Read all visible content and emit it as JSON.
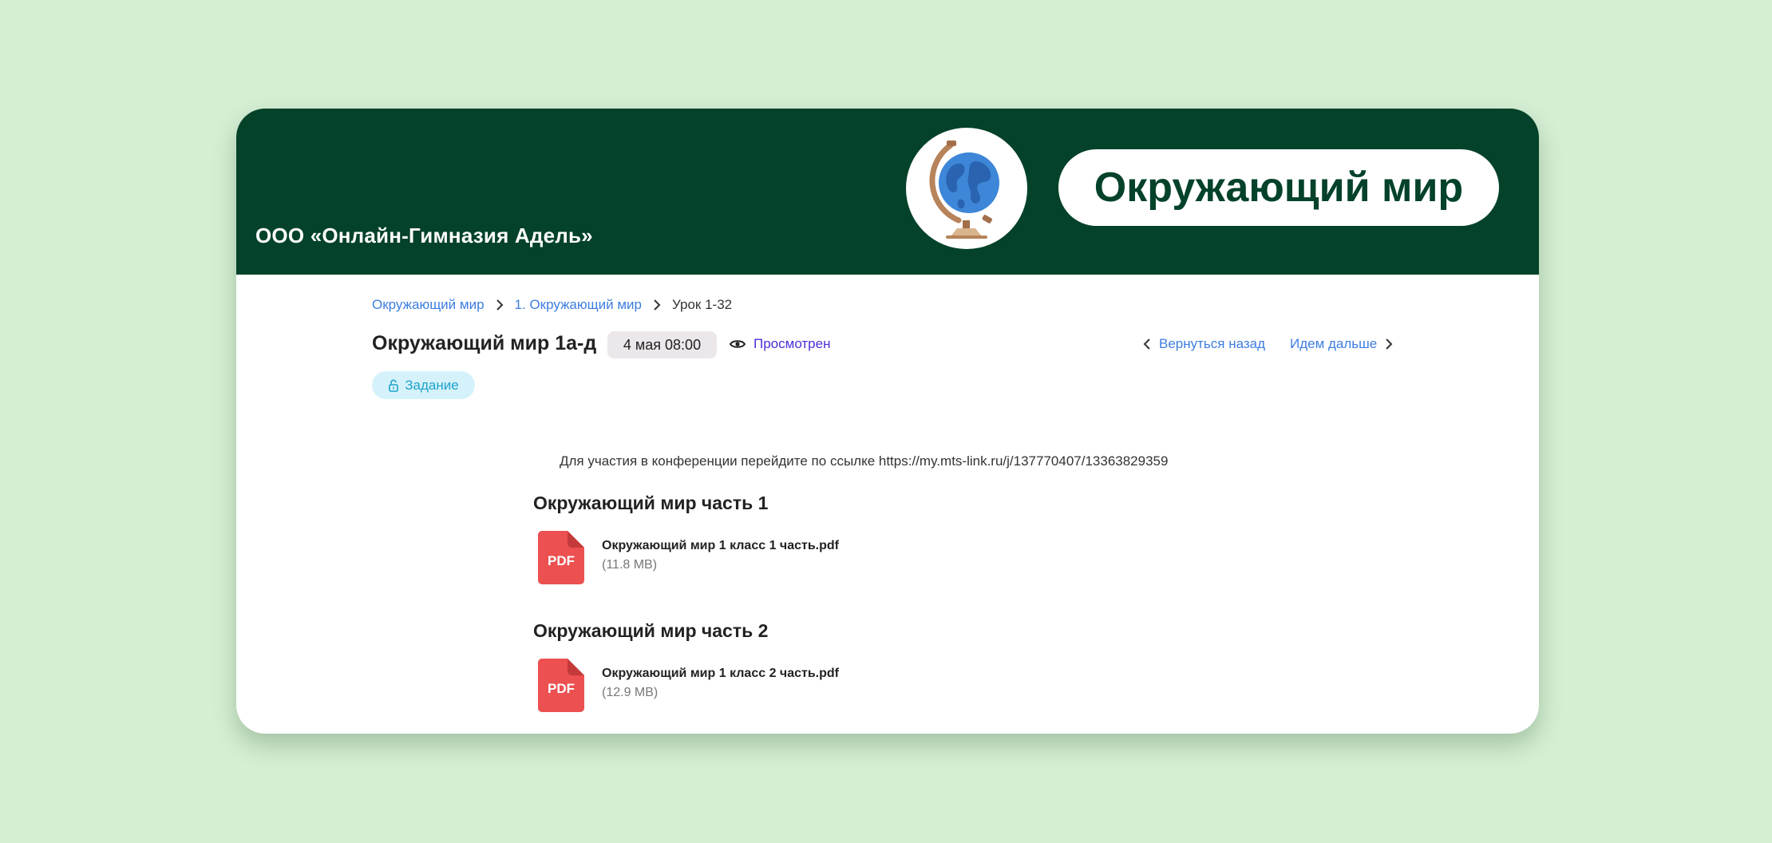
{
  "header": {
    "org_name": "ООО «Онлайн-Гимназия Адель»",
    "subject_title": "Окружающий мир",
    "logo_icon": "globe-icon",
    "background_color": "#04422a"
  },
  "breadcrumb": {
    "items": [
      "Окружающий мир",
      "1. Окружающий мир"
    ],
    "current": "Урок 1-32"
  },
  "lesson": {
    "title": "Окружающий мир 1а-д",
    "date": "4 мая 08:00",
    "status": "Просмотрен",
    "task_label": "Задание"
  },
  "navigation": {
    "back_label": "Вернуться назад",
    "next_label": "Идем дальше"
  },
  "content": {
    "conference_text": "Для участия в конференции перейдите по ссылке https://my.mts-link.ru/j/137770407/13363829359",
    "sections": [
      {
        "title": "Окружающий мир часть 1",
        "file": {
          "type": "PDF",
          "name": "Окружающий мир 1 класс 1 часть.pdf",
          "size": "(11.8 MB)"
        }
      },
      {
        "title": "Окружающий мир часть 2",
        "file": {
          "type": "PDF",
          "name": "Окружающий мир 1 класс 2 часть.pdf",
          "size": "(12.9 MB)"
        }
      }
    ]
  },
  "colors": {
    "page_background": "#d5efd4",
    "link": "#3d7de0",
    "viewed": "#4a2fd6",
    "task_badge_bg": "#d5f2fa",
    "task_badge_text": "#1ea2cc",
    "pdf_red": "#ec5050"
  }
}
